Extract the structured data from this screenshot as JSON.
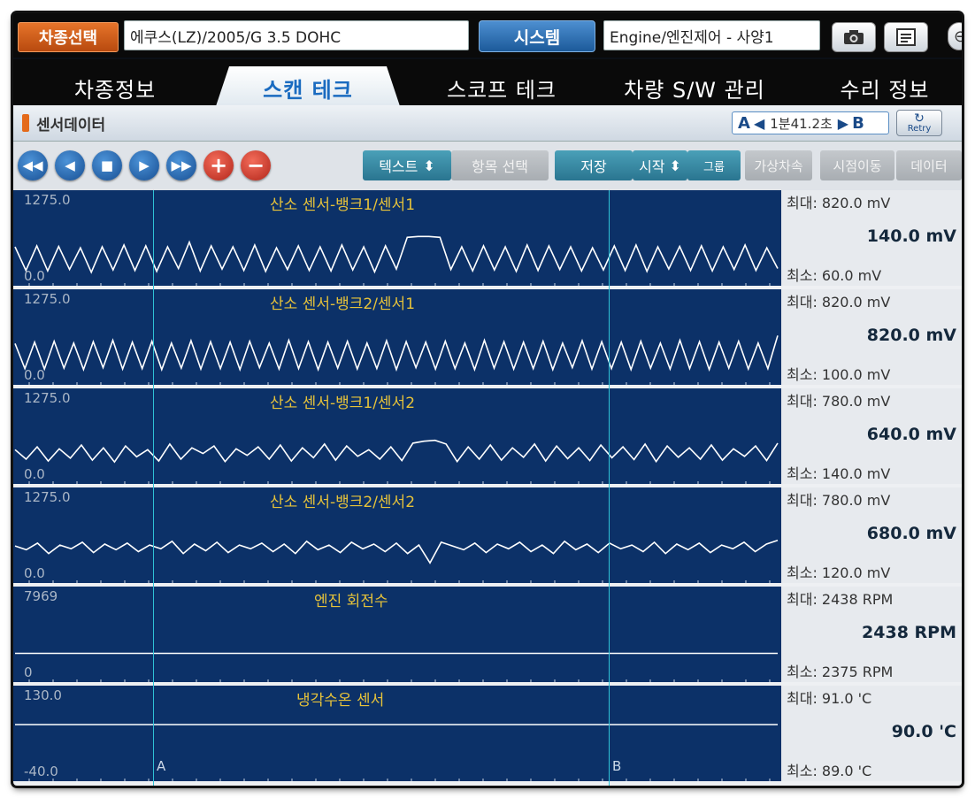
{
  "topbar": {
    "vehicle_select_label": "차종선택",
    "vehicle_value": "에쿠스(LZ)/2005/G 3.5 DOHC",
    "system_label": "시스템",
    "system_value": "Engine/엔진제어 - 사양1",
    "camera_icon": "camera-icon",
    "print_icon": "document-icon"
  },
  "tabs": [
    {
      "label": "차종정보"
    },
    {
      "label": "스캔 테크",
      "active": true
    },
    {
      "label": "스코프 테크"
    },
    {
      "label": "차량 S/W 관리"
    },
    {
      "label": "수리 정보"
    }
  ],
  "titlebar": {
    "title": "센서데이터",
    "a_label": "A",
    "b_label": "B",
    "time": "1분41.2초",
    "retry_label": "Retry"
  },
  "toolbar": {
    "buttons": [
      "텍스트",
      "항목 선택",
      "저장",
      "시작",
      "그룹",
      "가상차속",
      "시점이동",
      "데이터"
    ]
  },
  "colors": {
    "panel_bg": "#0c3168",
    "trace": "#ffffff",
    "title": "#e6c23a",
    "cursor": "#2fc2d6",
    "accent_orange": "#d35c18",
    "accent_blue": "#1f64b0"
  },
  "cursors": {
    "a_label": "A",
    "b_label": "B"
  },
  "chart_data": [
    {
      "type": "line",
      "title": "산소 센서-뱅크1/센서1",
      "ylim": [
        0.0,
        1275.0
      ],
      "y_max_label": "1275.0",
      "y_min_label": "0.0",
      "max": "최대: 820.0 mV",
      "current": "140.0 mV",
      "min": "최소: 60.0 mV",
      "series": [
        {
          "values": [
            600,
            100,
            620,
            90,
            610,
            120,
            580,
            60,
            600,
            110,
            640,
            100,
            620,
            80,
            600,
            140,
            700,
            90,
            620,
            130,
            600,
            100,
            640,
            80,
            580,
            120,
            620,
            100,
            600,
            90,
            640,
            110,
            600,
            70,
            620,
            130,
            800,
            820,
            820,
            800,
            120,
            600,
            90,
            620,
            110,
            600,
            80,
            640,
            100,
            620,
            120,
            600,
            90,
            580,
            110,
            620,
            100,
            640,
            80,
            600,
            130,
            610,
            100,
            620,
            90,
            600,
            120,
            640,
            100,
            580,
            140
          ]
        }
      ]
    },
    {
      "type": "line",
      "title": "산소 센서-뱅크2/센서1",
      "ylim": [
        0.0,
        1275.0
      ],
      "y_max_label": "1275.0",
      "y_min_label": "0.0",
      "max": "최대: 820.0 mV",
      "current": "820.0 mV",
      "min": "최소: 100.0 mV",
      "series": [
        {
          "values": [
            650,
            120,
            680,
            110,
            700,
            130,
            660,
            100,
            690,
            140,
            720,
            110,
            680,
            120,
            700,
            100,
            660,
            130,
            710,
            110,
            690,
            120,
            680,
            100,
            700,
            140,
            660,
            110,
            720,
            120,
            690,
            100,
            680,
            130,
            700,
            110,
            660,
            120,
            710,
            100,
            690,
            140,
            680,
            110,
            700,
            120,
            660,
            100,
            720,
            130,
            690,
            110,
            680,
            120,
            700,
            100,
            660,
            140,
            710,
            110,
            690,
            120,
            680,
            100,
            700,
            130,
            660,
            110,
            720,
            120,
            690,
            100,
            680,
            130,
            700,
            110,
            660,
            120,
            820
          ]
        }
      ]
    },
    {
      "type": "line",
      "title": "산소 센서-뱅크1/센서2",
      "ylim": [
        0.0,
        1275.0
      ],
      "y_max_label": "1275.0",
      "y_min_label": "0.0",
      "max": "최대: 780.0 mV",
      "current": "640.0 mV",
      "min": "최소: 140.0 mV",
      "series": [
        {
          "values": [
            500,
            300,
            560,
            260,
            520,
            320,
            600,
            280,
            540,
            240,
            580,
            350,
            500,
            260,
            620,
            300,
            540,
            420,
            580,
            250,
            520,
            380,
            560,
            300,
            600,
            260,
            540,
            330,
            620,
            280,
            580,
            360,
            500,
            300,
            560,
            270,
            640,
            680,
            700,
            620,
            250,
            560,
            300,
            600,
            280,
            540,
            340,
            620,
            260,
            580,
            310,
            540,
            270,
            600,
            330,
            560,
            290,
            620,
            250,
            580,
            340,
            540,
            300,
            600,
            280,
            520,
            360,
            580,
            270,
            640
          ]
        }
      ]
    },
    {
      "type": "line",
      "title": "산소 센서-뱅크2/센서2",
      "ylim": [
        0.0,
        1275.0
      ],
      "y_max_label": "1275.0",
      "y_min_label": "0.0",
      "max": "최대: 780.0 mV",
      "current": "680.0 mV",
      "min": "최소: 120.0 mV",
      "series": [
        {
          "values": [
            560,
            480,
            620,
            400,
            580,
            500,
            640,
            420,
            600,
            480,
            620,
            440,
            580,
            500,
            660,
            400,
            600,
            460,
            640,
            420,
            580,
            500,
            620,
            440,
            600,
            400,
            660,
            480,
            580,
            420,
            640,
            500,
            600,
            440,
            620,
            400,
            580,
            200,
            640,
            560,
            480,
            620,
            420,
            600,
            500,
            640,
            440,
            580,
            400,
            660,
            480,
            600,
            420,
            620,
            500,
            580,
            440,
            640,
            400,
            600,
            480,
            620,
            420,
            580,
            500,
            640,
            440,
            600,
            680
          ]
        }
      ]
    },
    {
      "type": "line",
      "title": "엔진 회전수",
      "ylim": [
        0,
        7969
      ],
      "y_max_label": "7969",
      "y_min_label": "0",
      "max": "최대:  2438 RPM",
      "current": "2438 RPM",
      "min": "최소:  2375 RPM",
      "series": [
        {
          "values": [
            2400,
            2400,
            2400,
            2400,
            2400,
            2400,
            2400,
            2400,
            2400,
            2400,
            2400,
            2400,
            2400,
            2400,
            2400,
            2400,
            2400,
            2400,
            2400,
            2400
          ]
        }
      ]
    },
    {
      "type": "line",
      "title": "냉각수온 센서",
      "ylim": [
        -40.0,
        130.0
      ],
      "y_max_label": "130.0",
      "y_min_label": "-40.0",
      "max": "최대:  91.0 'C",
      "current": "90.0 'C",
      "min": "최소:  89.0 'C",
      "series": [
        {
          "values": [
            90,
            90,
            90,
            90,
            90,
            90,
            90,
            90,
            90,
            90,
            90,
            90,
            90,
            90,
            90,
            90,
            90,
            90,
            90,
            90
          ]
        }
      ]
    }
  ]
}
